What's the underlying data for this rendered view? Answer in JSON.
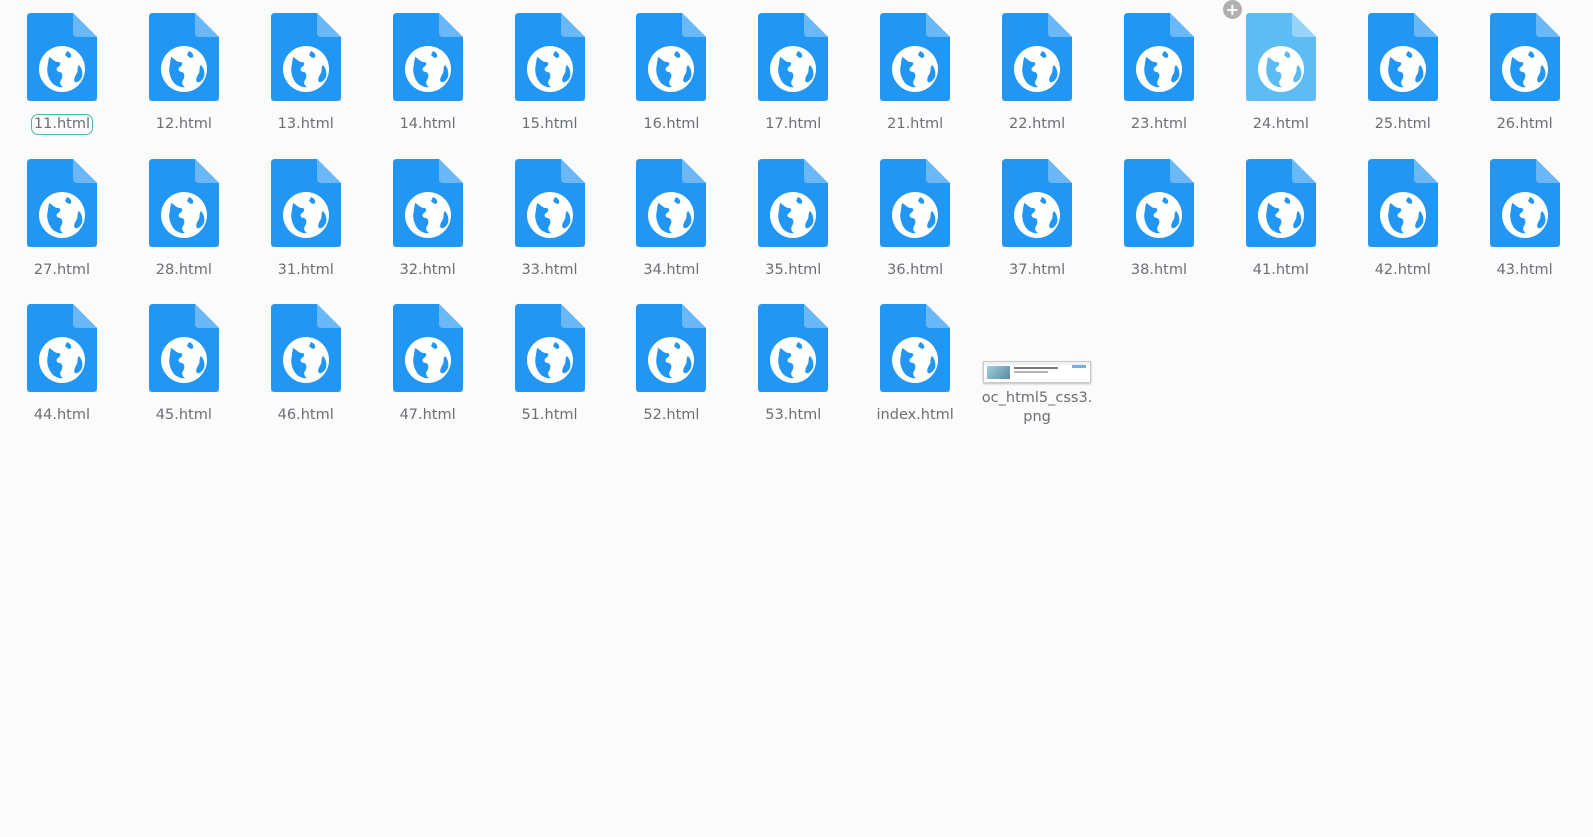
{
  "files": [
    {
      "name": "11.html",
      "type": "html",
      "state": "focused"
    },
    {
      "name": "12.html",
      "type": "html"
    },
    {
      "name": "13.html",
      "type": "html"
    },
    {
      "name": "14.html",
      "type": "html"
    },
    {
      "name": "15.html",
      "type": "html"
    },
    {
      "name": "16.html",
      "type": "html"
    },
    {
      "name": "17.html",
      "type": "html"
    },
    {
      "name": "21.html",
      "type": "html"
    },
    {
      "name": "22.html",
      "type": "html"
    },
    {
      "name": "23.html",
      "type": "html"
    },
    {
      "name": "24.html",
      "type": "html",
      "state": "hovered"
    },
    {
      "name": "25.html",
      "type": "html"
    },
    {
      "name": "26.html",
      "type": "html"
    },
    {
      "name": "27.html",
      "type": "html"
    },
    {
      "name": "28.html",
      "type": "html"
    },
    {
      "name": "31.html",
      "type": "html"
    },
    {
      "name": "32.html",
      "type": "html"
    },
    {
      "name": "33.html",
      "type": "html"
    },
    {
      "name": "34.html",
      "type": "html"
    },
    {
      "name": "35.html",
      "type": "html"
    },
    {
      "name": "36.html",
      "type": "html"
    },
    {
      "name": "37.html",
      "type": "html"
    },
    {
      "name": "38.html",
      "type": "html"
    },
    {
      "name": "41.html",
      "type": "html"
    },
    {
      "name": "42.html",
      "type": "html"
    },
    {
      "name": "43.html",
      "type": "html"
    },
    {
      "name": "44.html",
      "type": "html"
    },
    {
      "name": "45.html",
      "type": "html"
    },
    {
      "name": "46.html",
      "type": "html"
    },
    {
      "name": "47.html",
      "type": "html"
    },
    {
      "name": "51.html",
      "type": "html"
    },
    {
      "name": "52.html",
      "type": "html"
    },
    {
      "name": "53.html",
      "type": "html"
    },
    {
      "name": "index.html",
      "type": "html"
    },
    {
      "name": "oc_html5_css3.png",
      "type": "image"
    }
  ],
  "icons": {
    "html": "globe-document-icon",
    "image": "image-thumbnail",
    "selection_badge": "plus-icon"
  },
  "badge": {
    "symbol": "+"
  },
  "colors": {
    "background": "#fbfbfb",
    "file_icon": "#2196f3",
    "file_icon_fold": "#6ab8f7",
    "file_icon_hover": "#5bbcf3",
    "label_text": "#6b6f74",
    "focus_ring": "#4fb6a8"
  }
}
